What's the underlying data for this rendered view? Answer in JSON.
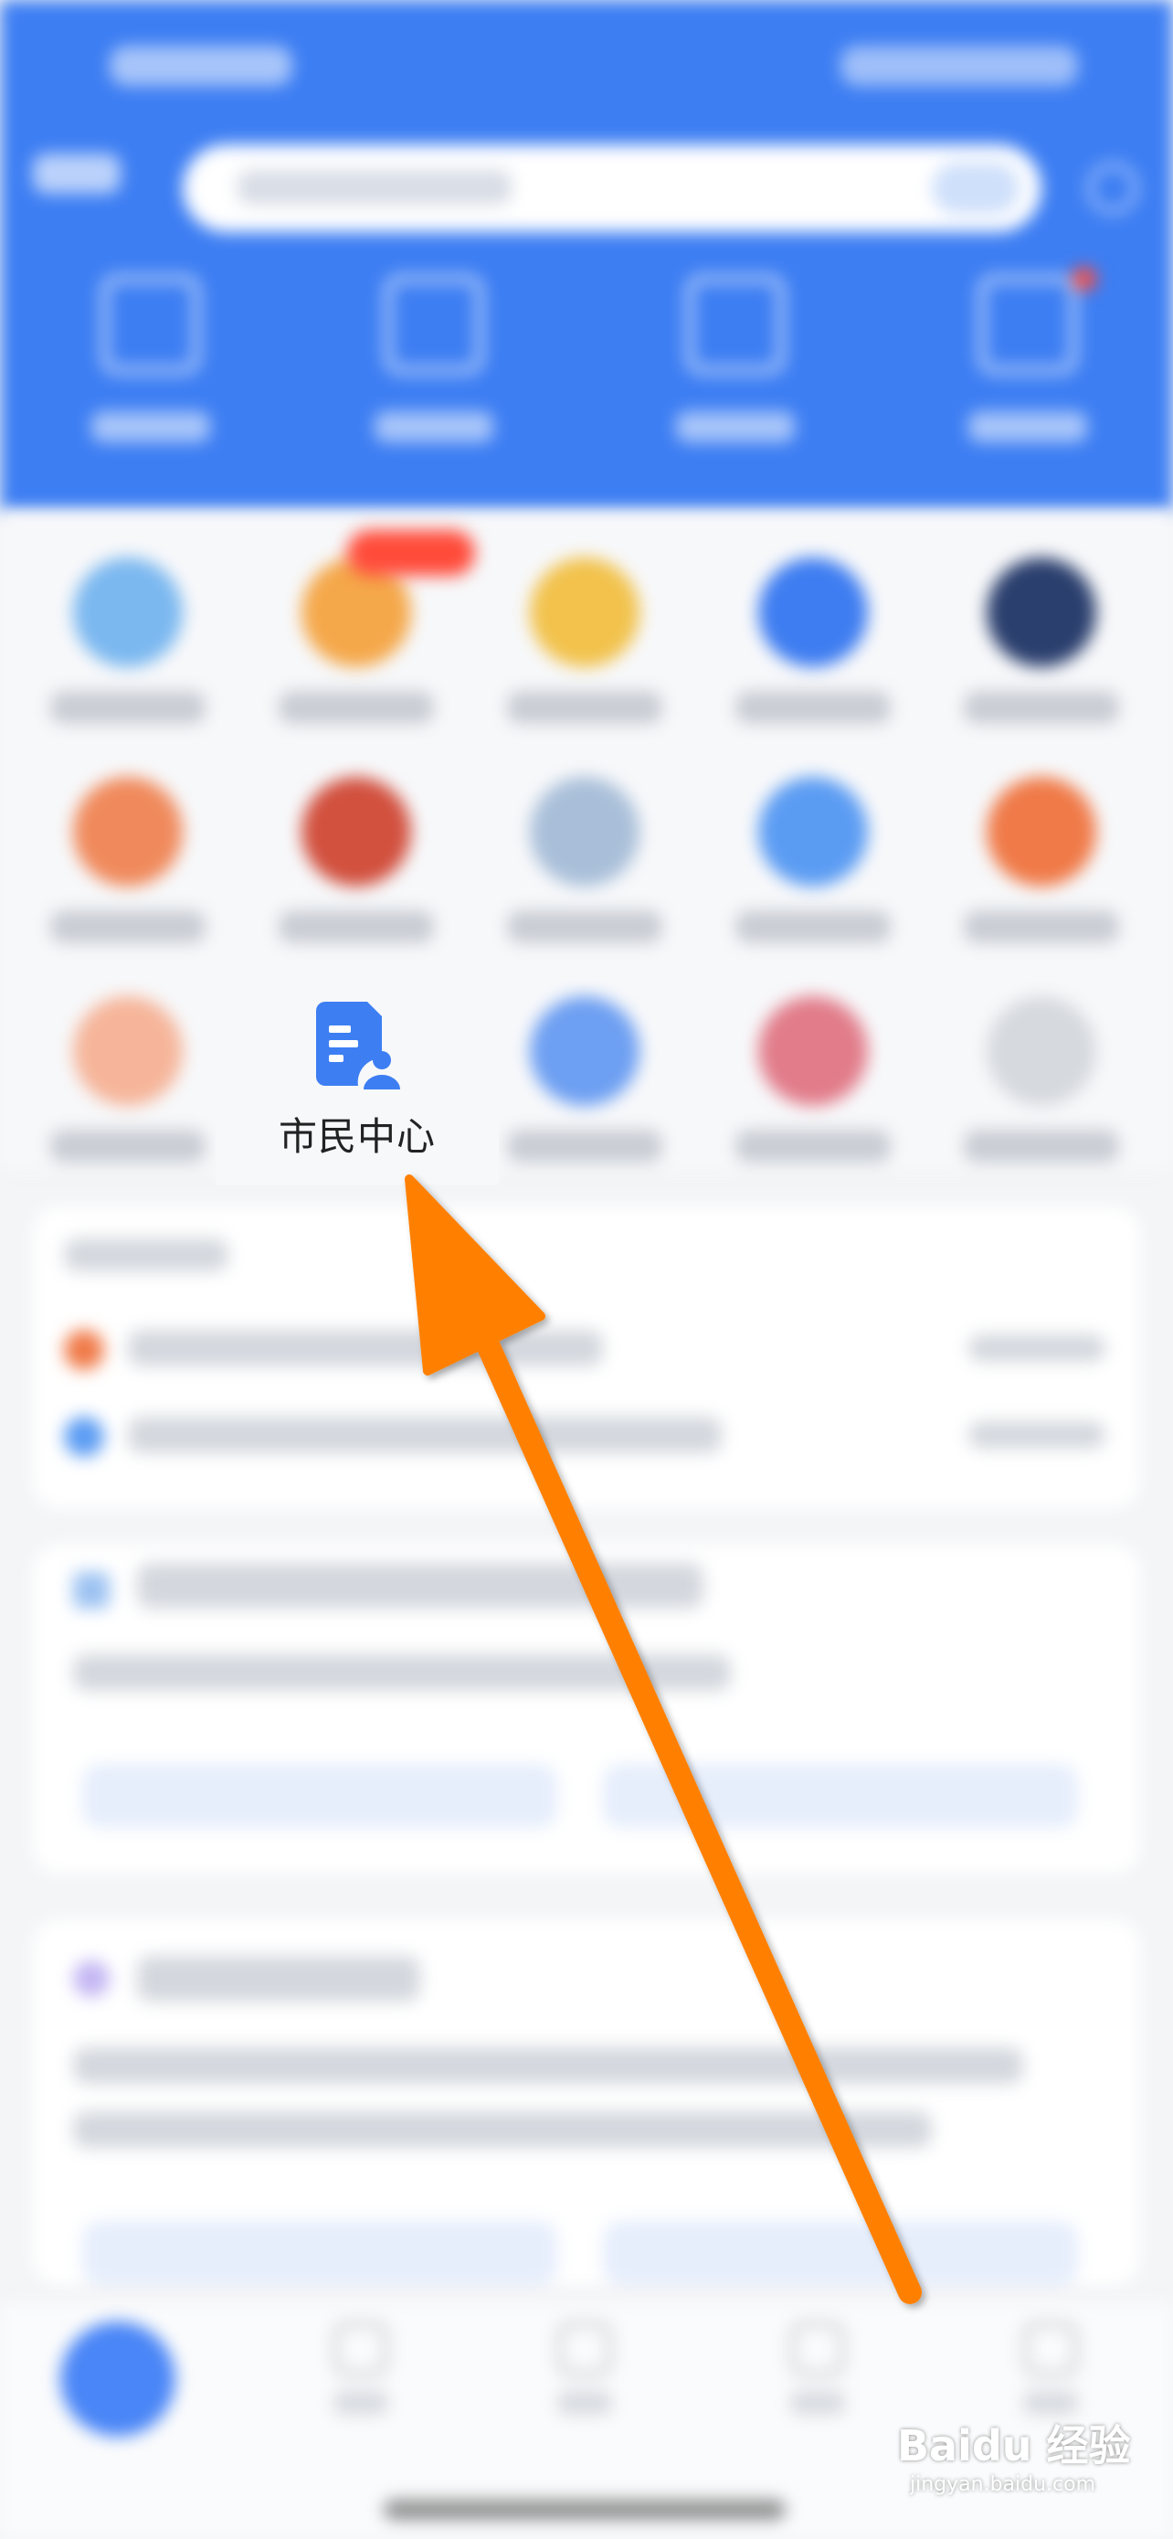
{
  "focus_item": {
    "label": "市民中心",
    "icon": "document-user-icon"
  },
  "watermark": {
    "brand": "Baidu 经验",
    "url": "jingyan.baidu.com"
  },
  "colors": {
    "header_blue": "#3d7ef3",
    "icon_blue": "#3d7ef3",
    "arrow_orange": "#ff8000"
  }
}
